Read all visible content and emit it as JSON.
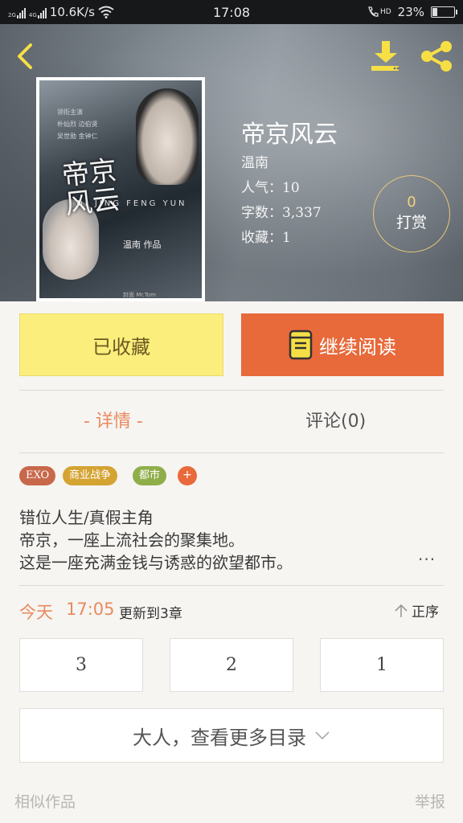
{
  "status_bar": {
    "network_speed": "10.6K/s",
    "time": "17:08",
    "battery_percent": "23%",
    "battery_level": 0.23,
    "signal_labels": [
      "2G",
      "4G"
    ],
    "hd_label": "HD"
  },
  "book": {
    "title": "帝京风云",
    "author": "温南",
    "popularity": "人气：10",
    "word_count": "字数：3,337",
    "favorites": "收藏：1",
    "tip_count": "0",
    "tip_label": "打赏"
  },
  "cover": {
    "credit": "领衔主演\n朴灿烈 边伯贤\n吴世勋 金钟仁",
    "title": "帝京风云",
    "subtitle": "DI JING FENG YUN",
    "author_text": "温南 作品",
    "footer": "封面 Mr.Tom"
  },
  "actions": {
    "favorited_label": "已收藏",
    "continue_label": "继续阅读"
  },
  "tabs": {
    "detail": "- 详情 -",
    "comments": "评论(0)"
  },
  "tags": [
    {
      "label": "EXO",
      "color": "#c8684b"
    },
    {
      "label": "商业战争",
      "color": "#d4a332"
    },
    {
      "label": "都市",
      "color": "#8fae4a"
    }
  ],
  "tag_add": "+",
  "description": [
    "错位人生/真假主角",
    "帝京，一座上流社会的聚集地。",
    "这是一座充满金钱与诱惑的欲望都市。"
  ],
  "more_dots": "···",
  "update": {
    "today": "今天",
    "time": "17:05",
    "text": "更新到3章",
    "sort_label": "正序"
  },
  "chapters": [
    "3",
    "2",
    "1"
  ],
  "more_toc": "大人，查看更多目录",
  "footer": {
    "similar": "相似作品",
    "report": "举报"
  },
  "colors": {
    "accent_orange": "#e8693a",
    "favorite_yellow": "#fbee7c",
    "icon_yellow": "#f6df45"
  }
}
